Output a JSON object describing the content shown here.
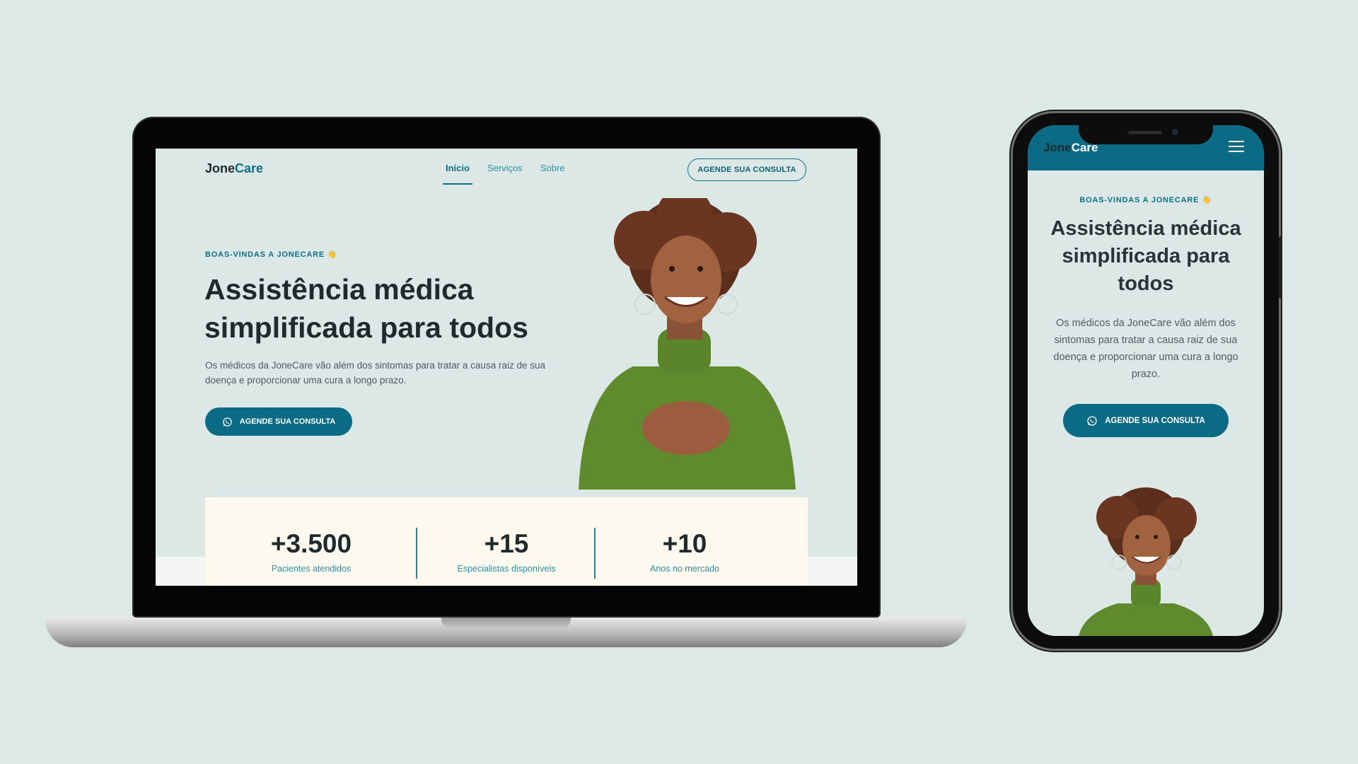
{
  "colors": {
    "background": "#dce9e6",
    "brand": "#0b6a84",
    "accent_text": "#2f8fa4",
    "stats_card": "#fdf9ee",
    "heading": "#1f2a2d"
  },
  "desktop": {
    "logo": {
      "part1": "Jone",
      "part2": "Care"
    },
    "nav": {
      "items": [
        "Início",
        "Serviços",
        "Sobre"
      ],
      "active_index": 0
    },
    "header_cta": "AGENDE SUA CONSULTA",
    "hero": {
      "eyebrow": "BOAS-VINDAS A JONECARE 👋",
      "title": "Assistência médica simplificada para todos",
      "description": "Os médicos da JoneCare vão além dos sintomas para tratar a causa raiz de sua doença e proporcionar uma cura a longo prazo.",
      "cta": "AGENDE SUA CONSULTA",
      "cta_icon": "whatsapp-icon"
    },
    "stats": [
      {
        "value": "+3.500",
        "label": "Pacientes atendidos"
      },
      {
        "value": "+15",
        "label": "Especialistas disponíveis"
      },
      {
        "value": "+10",
        "label": "Anos no mercado"
      }
    ]
  },
  "mobile": {
    "logo": {
      "part1": "Jone",
      "part2": "Care"
    },
    "menu_icon": "hamburger-icon",
    "hero": {
      "eyebrow": "BOAS-VINDAS A JONECARE 👋",
      "title": "Assistência médica simplificada para todos",
      "description": "Os médicos da JoneCare vão além dos sintomas para tratar a causa raiz de sua doença e proporcionar uma cura a longo prazo.",
      "cta": "AGENDE SUA CONSULTA",
      "cta_icon": "whatsapp-icon"
    }
  }
}
